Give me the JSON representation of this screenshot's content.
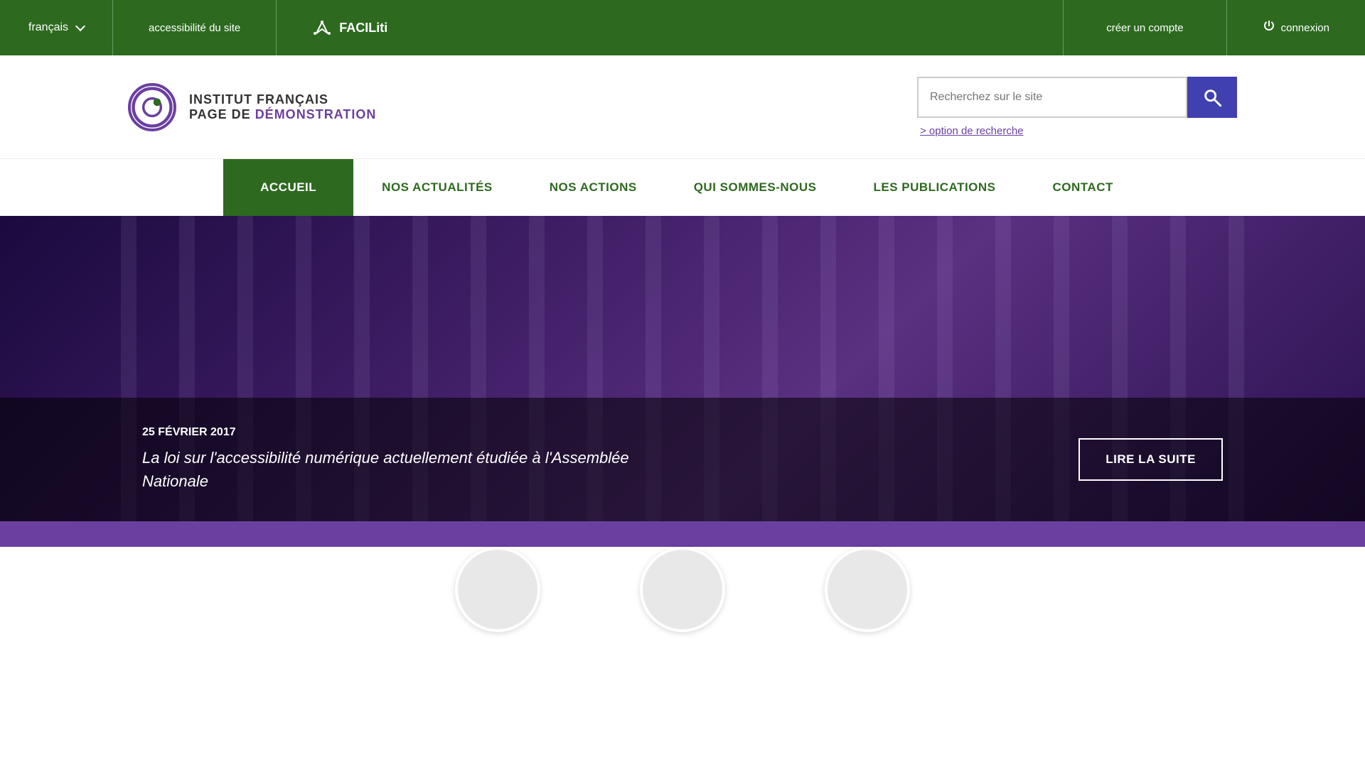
{
  "topbar": {
    "lang_label": "français",
    "accessibility_label": "accessibilité du site",
    "faciliti_label": "FACILiti",
    "creer_label": "créer un compte",
    "connexion_label": "connexion"
  },
  "header": {
    "logo_title": "INSTITUT FRANÇAIS",
    "logo_subtitle_prefix": "PAGE DE ",
    "logo_subtitle_highlight": "DÉMONSTRATION",
    "search_placeholder": "Recherchez sur le site",
    "search_option_label": "> option de recherche"
  },
  "nav": {
    "items": [
      {
        "label": "ACCUEIL",
        "active": true
      },
      {
        "label": "NOS ACTUALITÉS",
        "active": false
      },
      {
        "label": "NOS ACTIONS",
        "active": false
      },
      {
        "label": "QUI SOMMES-NOUS",
        "active": false
      },
      {
        "label": "LES PUBLICATIONS",
        "active": false
      },
      {
        "label": "CONTACT",
        "active": false
      }
    ]
  },
  "hero": {
    "date": "25 FÉVRIER 2017",
    "title": "La loi sur l'accessibilité numérique actuellement étudiée à l'Assemblée Nationale",
    "cta_label": "LIRE LA SUITE"
  },
  "circles": [
    {
      "id": "circle-1"
    },
    {
      "id": "circle-2"
    },
    {
      "id": "circle-3"
    }
  ]
}
